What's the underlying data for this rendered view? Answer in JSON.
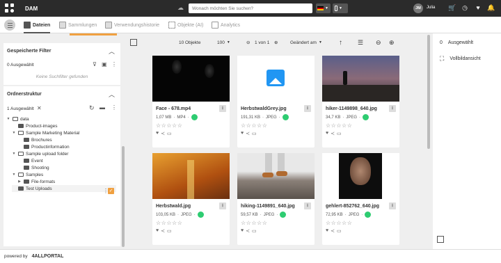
{
  "app": {
    "name": "DAM"
  },
  "search": {
    "placeholder": "Wonach möchten Sie suchen?"
  },
  "user": {
    "initials": "JM",
    "name": "Julia"
  },
  "nav": {
    "tabs": [
      {
        "label": "Dateien"
      },
      {
        "label": "Sammlungen"
      },
      {
        "label": "Verwendungshistorie"
      },
      {
        "label": "Objekte (AI)"
      },
      {
        "label": "Analytics"
      }
    ]
  },
  "filters": {
    "title": "Gespeicherte Filter",
    "selected": "0 Ausgewählt",
    "empty": "Keine Suchfilter gefunden"
  },
  "folders": {
    "title": "Ordnerstruktur",
    "selected": "1 Ausgewählt",
    "tree": [
      {
        "label": "data"
      },
      {
        "label": "Product-images"
      },
      {
        "label": "Sample Marketing Material"
      },
      {
        "label": "Brochures"
      },
      {
        "label": "Productinformation"
      },
      {
        "label": "Sample upload folder"
      },
      {
        "label": "Event"
      },
      {
        "label": "Shooting"
      },
      {
        "label": "Samples"
      },
      {
        "label": "File-formats"
      },
      {
        "label": "Test Uploads"
      }
    ]
  },
  "toolbar": {
    "objects": "10 Objekte",
    "per_page": "100",
    "page": "1 von 1",
    "sort": "Geändert am"
  },
  "assets": [
    {
      "name": "Face - 678.mp4",
      "size": "1,07 MB",
      "type": "MP4"
    },
    {
      "name": "HerbstwaldGrey.jpg",
      "size": "191,31 KB",
      "type": "JPEG"
    },
    {
      "name": "hiker-1149898_640.jpg",
      "size": "34,7 KB",
      "type": "JPEG"
    },
    {
      "name": "Herbstwald.jpg",
      "size": "103,05 KB",
      "type": "JPEG"
    },
    {
      "name": "hiking-1149891_640.jpg",
      "size": "59,57 KB",
      "type": "JPEG"
    },
    {
      "name": "gehlert-852762_640.jpg",
      "size": "72,95 KB",
      "type": "JPEG"
    }
  ],
  "right_panel": {
    "selected_count": "0",
    "selected_label": "Ausgewählt",
    "fullscreen_label": "Vollbildansicht"
  },
  "footer": {
    "powered_by": "powered by",
    "brand": "4ALLPORTAL"
  },
  "colors": {
    "accent": "#f0a040",
    "topbar": "#2b2b2b",
    "status": "#2ecc71"
  }
}
